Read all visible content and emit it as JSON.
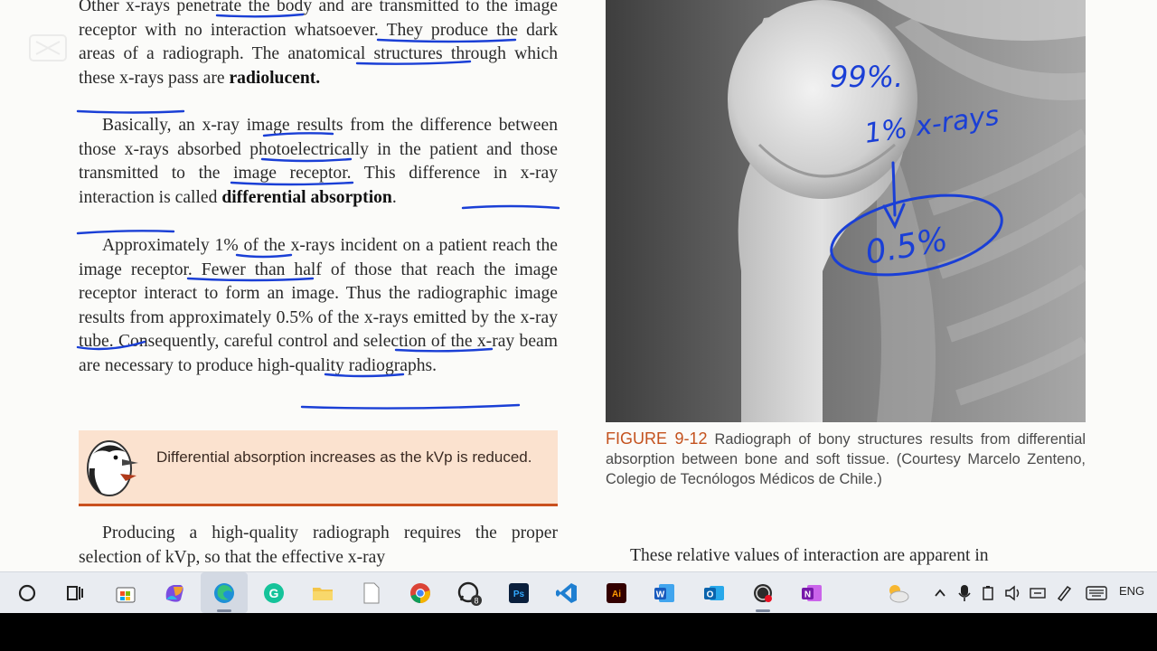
{
  "book": {
    "p1": {
      "line1": "Other x-rays penetrate the body and are transmitted to the image receptor with no interaction whatsoever. They produce the dark areas of a radiograph. The anatomical structures through which these x-rays pass are ",
      "term": "radiolucent."
    },
    "p2": {
      "text": "Basically, an x-ray image results from the difference between those x-rays absorbed photoelectrically in the patient and those transmitted to the image receptor. This difference in x-ray interaction is called ",
      "term": "differential absorption",
      "end": "."
    },
    "p3": {
      "text": "Approximately 1% of the x-rays incident on a patient reach the image receptor. Fewer than half of those that reach the image receptor interact to form an image. Thus the radiographic image results from approximately 0.5% of the x-rays emitted by the x-ray tube. Consequently, careful control and selection of the x-ray beam are necessary to produce high-quality radiographs."
    },
    "callout": {
      "text": "Differential absorption increases as the kVp is reduced.",
      "icon": "penguin-icon",
      "bg_color": "#fbe2cf",
      "border_color": "#c9501e"
    },
    "p4": {
      "text": "Producing a high-quality radiograph requires the proper selection of kVp, so that the effective x-ray"
    },
    "figure": {
      "label": "FIGURE 9-12",
      "caption": " Radiograph of bony structures results from differential absorption between bone and soft tissue. (Courtesy Marcelo Zenteno, Colegio de Tecnólogos Médicos de Chile.)",
      "label_color": "#c4521e"
    },
    "right_para": "These relative values of interaction are apparent in"
  },
  "annotations": {
    "ink_color": "#1a3fd6",
    "note1": "99%.",
    "note2": "1% x-rays",
    "note3": "0.5%"
  },
  "taskbar": {
    "icons": [
      "search-circle-icon",
      "task-view-icon",
      "store-icon",
      "copilot-icon",
      "edge-icon",
      "grammarly-icon",
      "file-explorer-icon",
      "document-icon",
      "chrome-icon",
      "whatsapp-icon",
      "photoshop-icon",
      "vscode-icon",
      "illustrator-icon",
      "word-icon",
      "outlook-icon",
      "obs-icon",
      "onenote-icon"
    ],
    "whatsapp_badge": "8",
    "language": "ENG",
    "labels": {
      "store": "",
      "grammarly": "G",
      "photoshop": "Ps",
      "illustrator": "Ai",
      "word": "W",
      "outlook": "O",
      "onenote": "N"
    }
  }
}
